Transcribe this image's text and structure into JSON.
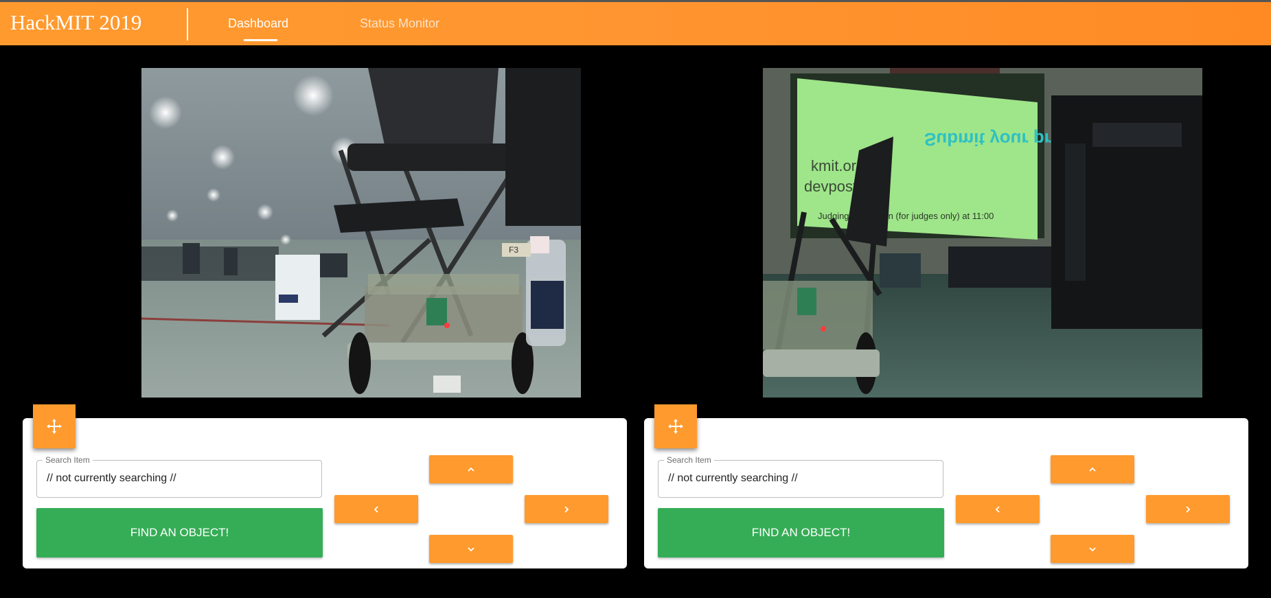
{
  "app": {
    "title": "HackMIT 2019",
    "tabs": [
      {
        "label": "Dashboard",
        "active": true
      },
      {
        "label": "Status Monitor",
        "active": false
      }
    ]
  },
  "panels": [
    {
      "search": {
        "label": "Search Item",
        "value": "// not currently searching //"
      },
      "find_label": "FIND AN OBJECT!",
      "feed_description": "robot camera feed",
      "controls": [
        "up",
        "left",
        "right",
        "down"
      ]
    },
    {
      "search": {
        "label": "Search Item",
        "value": "// not currently searching //"
      },
      "find_label": "FIND AN OBJECT!",
      "feed_description": "robot camera feed",
      "controls": [
        "up",
        "left",
        "right",
        "down"
      ]
    }
  ],
  "camera_left": {
    "screen_text": "F3"
  },
  "camera_right": {
    "screen_lines": [
      "Submit your project!!",
      "kmit.org",
      "devpost",
      "Judging orientation (for judges only) at 11:00"
    ]
  },
  "colors": {
    "accent": "#ff9a2e",
    "find_button": "#35ad56",
    "background": "#000000",
    "panel": "#ffffff"
  },
  "icons": {
    "move": "move-icon",
    "up": "chevron-up-icon",
    "left": "chevron-left-icon",
    "right": "chevron-right-icon",
    "down": "chevron-down-icon"
  }
}
